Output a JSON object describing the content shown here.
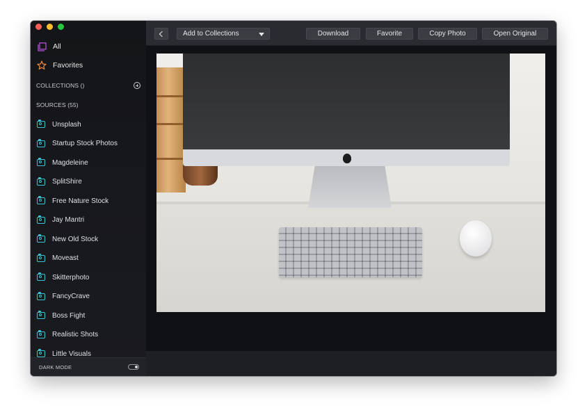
{
  "sidebar": {
    "all_label": "All",
    "favorites_label": "Favorites",
    "collections_header": "COLLECTIONS ()",
    "sources_header": "SOURCES (55)",
    "sources": [
      "Unsplash",
      "Startup Stock Photos",
      "Magdeleine",
      "SplitShire",
      "Free Nature Stock",
      "Jay Mantri",
      "New Old Stock",
      "Moveast",
      "Skitterphoto",
      "FancyCrave",
      "Boss Fight",
      "Realistic Shots",
      "Little Visuals"
    ],
    "dark_mode_label": "DARK MODE",
    "dark_mode_on": true
  },
  "toolbar": {
    "collections_select": "Add to Collections",
    "download_label": "Download",
    "favorite_label": "Favorite",
    "copy_photo_label": "Copy Photo",
    "open_original_label": "Open Original"
  },
  "colors": {
    "accent_camera": "#3cc4d4",
    "all_icon": "#b04fd6",
    "favorites_icon": "#f08a3a",
    "sidebar_bg": "#141518",
    "toolbar_bg": "#2a2b30"
  },
  "icons": {
    "all": "gallery-icon",
    "favorites": "star-icon",
    "source": "camera-icon",
    "add_collection": "plus-circle-icon",
    "back": "chevron-left-icon",
    "select": "caret-down-icon"
  }
}
